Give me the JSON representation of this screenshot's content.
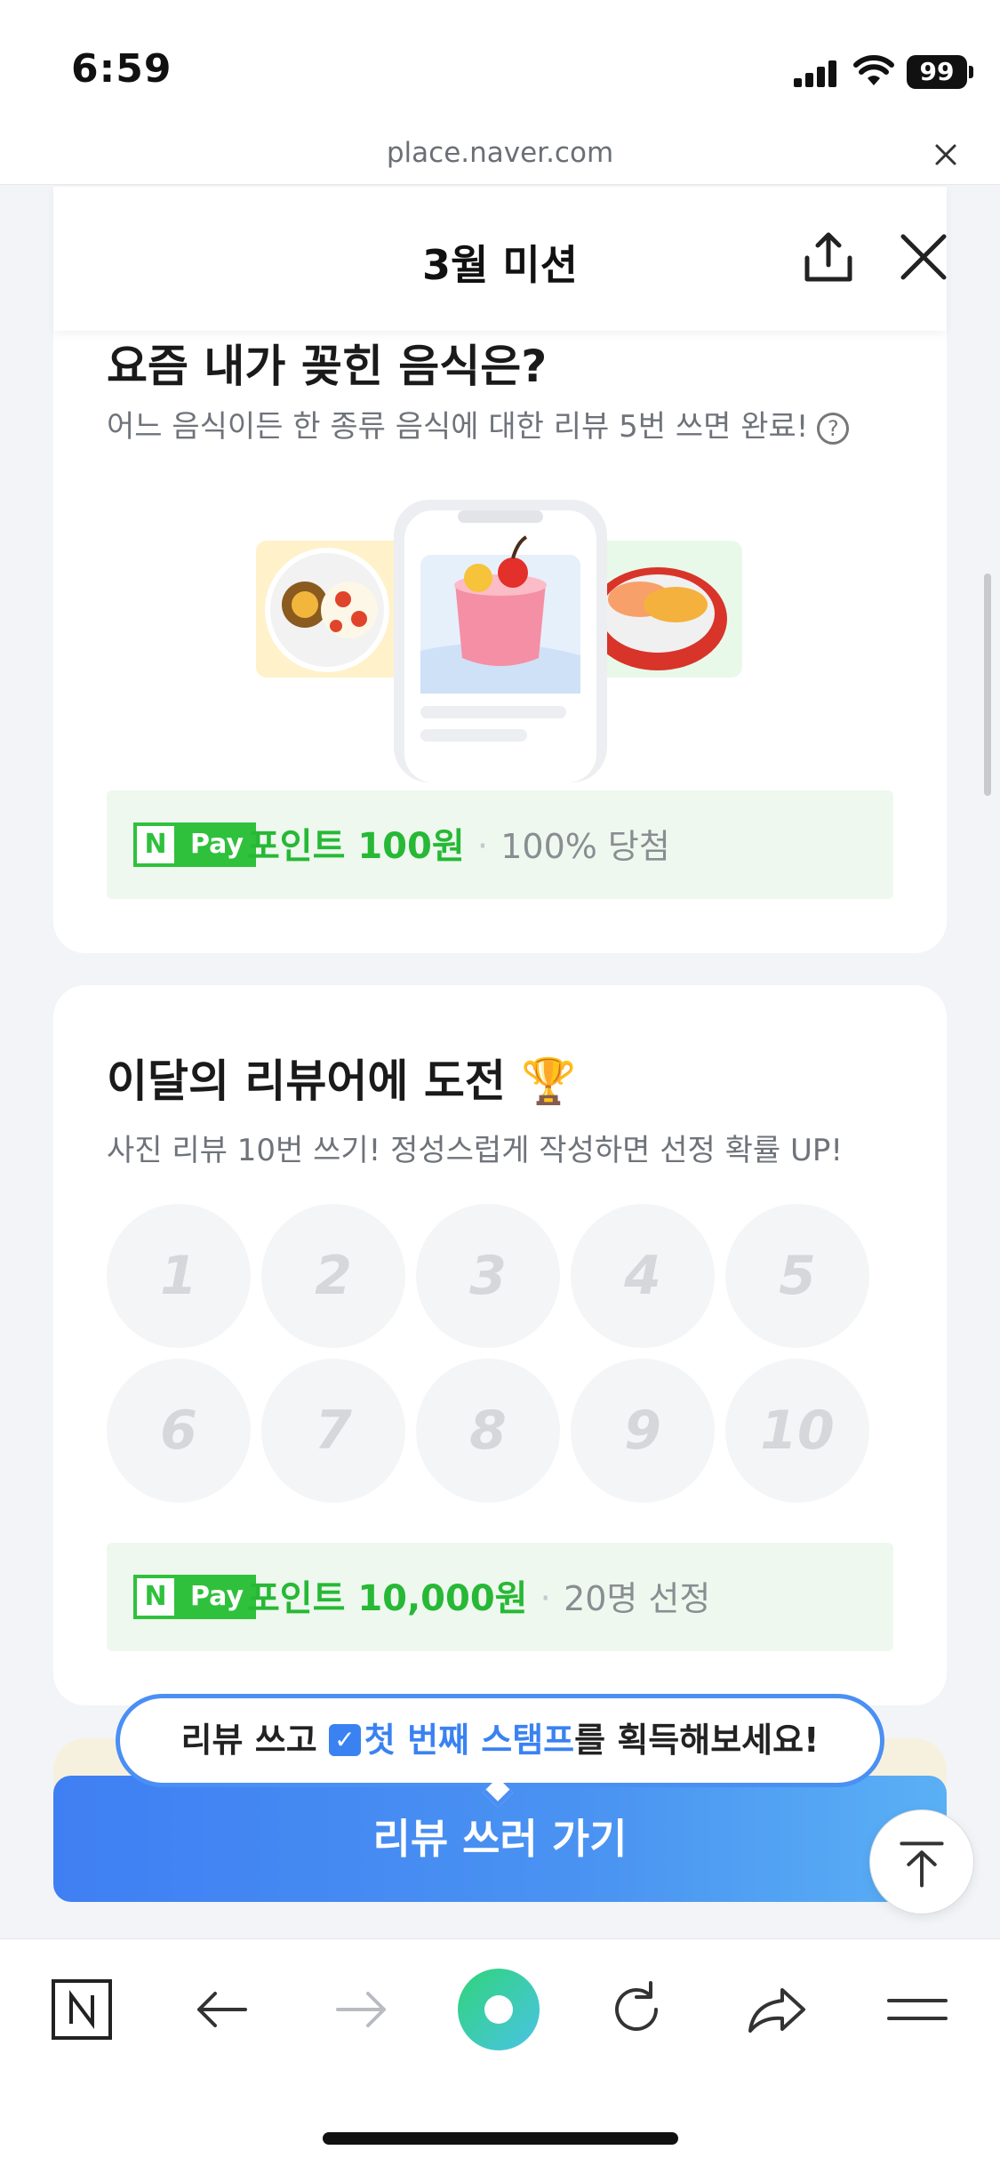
{
  "status_bar": {
    "time": "6:59",
    "battery": "99"
  },
  "browser": {
    "url": "place.naver.com"
  },
  "header": {
    "title": "3월 미션"
  },
  "mission1": {
    "title": "요즘 내가 꽂힌 음식은?",
    "subtitle": "어느 음식이든 한 종류 음식에 대한 리뷰 5번 쓰면 완료!",
    "help_symbol": "?",
    "reward": {
      "badge_n": "N",
      "badge_pay": "Pay",
      "amount": "포인트 100원",
      "separator": "·",
      "extra": "100% 당첨"
    }
  },
  "mission2": {
    "title": "이달의 리뷰어에 도전 🏆",
    "subtitle": "사진 리뷰 10번 쓰기! 정성스럽게 작성하면 선정 확률 UP!",
    "stamps": [
      "1",
      "2",
      "3",
      "4",
      "5",
      "6",
      "7",
      "8",
      "9",
      "10"
    ],
    "reward": {
      "badge_n": "N",
      "badge_pay": "Pay",
      "amount": "포인트 10,000원",
      "separator": "·",
      "extra": "20명 선정"
    }
  },
  "tooltip": {
    "prefix": "리뷰 쓰고 ",
    "check": "✓",
    "highlight": "첫 번째 스탬프",
    "suffix": "를 획득해보세요!"
  },
  "cta": {
    "label": "리뷰 쓰러 가기"
  },
  "colors": {
    "accent_blue": "#3f7ff3",
    "naver_green": "#2fc13c"
  }
}
